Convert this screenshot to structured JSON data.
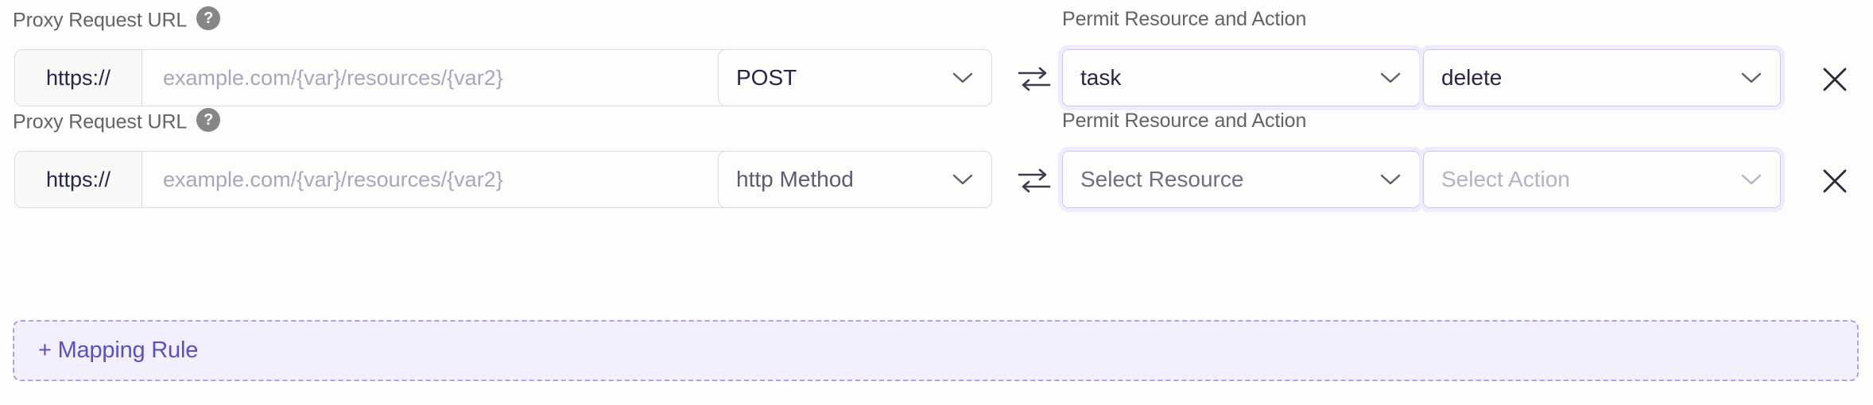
{
  "rows": [
    {
      "url_label": "Proxy Request URL",
      "help_glyph": "?",
      "scheme": "https://",
      "url_value": "",
      "url_placeholder": "example.com/{var}/resources/{var2}",
      "method_value": "POST",
      "method_is_placeholder": false,
      "permit_label": "Permit Resource and Action",
      "resource_value": "task",
      "resource_is_placeholder": false,
      "action_value": "delete",
      "action_is_placeholder": false,
      "resource_focused": true,
      "action_focused": true,
      "action_muted": false,
      "remove_label": "×"
    },
    {
      "url_label": "Proxy Request URL",
      "help_glyph": "?",
      "scheme": "https://",
      "url_value": "",
      "url_placeholder": "example.com/{var}/resources/{var2}",
      "method_value": "http Method",
      "method_is_placeholder": true,
      "permit_label": "Permit Resource and Action",
      "resource_value": "Select Resource",
      "resource_is_placeholder": true,
      "action_value": "Select Action",
      "action_is_placeholder": true,
      "resource_focused": true,
      "action_focused": true,
      "action_muted": true,
      "remove_label": "×"
    }
  ],
  "add_rule": {
    "label": "+ Mapping Rule"
  },
  "colors": {
    "accent": "#5b4fc4",
    "accent_bg": "#f2f0fe",
    "accent_border": "#a9a2ec",
    "focus_ring": "#eeecfd",
    "focus_border": "#c9c6f5",
    "text_dark": "#26264d",
    "text_label": "#636363",
    "placeholder": "#a7a7c2",
    "field_border": "#dcdce2",
    "prefix_bg": "#f8f8f7",
    "page_bg": "#fdfdfb",
    "help_bg": "#868686"
  },
  "icons": {
    "help": "help-icon",
    "swap": "swap-arrows-icon",
    "chevron": "chevron-down-icon",
    "close": "close-icon",
    "plus": "plus-icon"
  }
}
